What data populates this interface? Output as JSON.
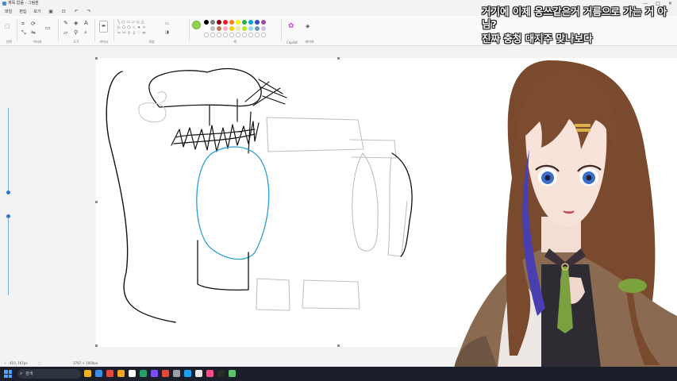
{
  "titlebar": {
    "title": "제목 없음 - 그림판",
    "controls": [
      "—",
      "□",
      "✕"
    ]
  },
  "menubar": {
    "items": [
      "파일",
      "편집",
      "보기"
    ],
    "quick_actions": [
      "save-icon",
      "crop-icon",
      "undo-icon",
      "redo-icon"
    ]
  },
  "ribbon": {
    "groups": {
      "selection": "선택",
      "image": "이미지",
      "tools": "도구",
      "brushes": "브러시",
      "shapes": "모양",
      "colors": "색",
      "copilot": "Copilot",
      "layers": "레이어"
    },
    "active_color": "#92d050",
    "palette_row1": [
      "#000000",
      "#7f7f7f",
      "#880015",
      "#ed1c24",
      "#ff7f27",
      "#fff200",
      "#22b14c",
      "#00a2e8",
      "#3f48cc",
      "#a349a4"
    ],
    "palette_row2": [
      "#ffffff",
      "#c3c3c3",
      "#b97a57",
      "#ffaec9",
      "#ffc90e",
      "#efe4b0",
      "#b5e61d",
      "#99d9ea",
      "#7092be",
      "#c8bfe7"
    ]
  },
  "statusbar": {
    "cursor": "410, 167px",
    "size": "1797 × 1000px"
  },
  "caption": {
    "line1": "거기에 이제 옹쓰같은거 거름으로 가는 거 아님?",
    "line2": "진짜 충청 대지주 맞나보다"
  },
  "taskbar": {
    "search_placeholder": "검색",
    "apps": [
      "#f2b01e",
      "#3b8fe0",
      "#e24a3b",
      "#f5a623",
      "#ffffff",
      "#25a06a",
      "#7c4dff",
      "#e24a3b",
      "#9aa0a6",
      "#1da1f2",
      "#e6e6e6",
      "#ff4f8b",
      "#2b2b2b",
      "#59c36a"
    ]
  }
}
